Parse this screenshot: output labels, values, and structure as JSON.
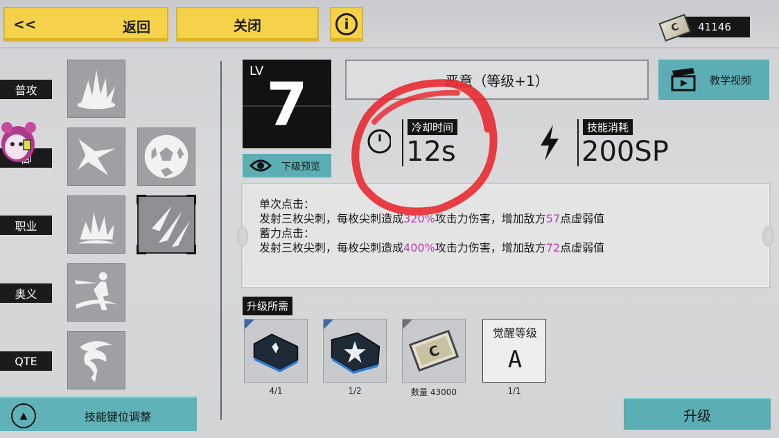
{
  "header": {
    "back_chevron": "<<",
    "back_label": "返回",
    "close_label": "关闭",
    "info_glyph": "i",
    "currency_value": "41146",
    "currency_icon": "ticket-icon"
  },
  "categories": [
    {
      "label": "普攻"
    },
    {
      "label": "御"
    },
    {
      "label": "职业"
    },
    {
      "label": "奥义"
    },
    {
      "label": "QTE"
    }
  ],
  "adjust_button": {
    "label": "技能键位调整",
    "icon": "rotate-icon"
  },
  "skill": {
    "lv_label": "LV",
    "level": "7",
    "preview_label": "下级预览",
    "name": "恶意（等级+1）",
    "tutorial_label": "教学视频",
    "cooldown_label": "冷却时间",
    "cooldown_value": "12s",
    "cost_label": "技能消耗",
    "cost_value": "200SP"
  },
  "description": {
    "line1": "单次点击：",
    "line2_a": "发射三枚尖刺，每枚尖刺造成",
    "line2_pct": "320%",
    "line2_b": "攻击力伤害，增加敌方",
    "line2_num": "57",
    "line2_c": "点虚弱值",
    "line3": "蓄力点击：",
    "line4_a": "发射三枚尖刺，每枚尖刺造成",
    "line4_pct": "400%",
    "line4_b": "攻击力伤害，增加敌方",
    "line4_num": "72",
    "line4_c": "点虚弱值"
  },
  "requirements": {
    "label": "升级所需",
    "items": [
      {
        "qty": "4/1"
      },
      {
        "qty": "1/2"
      },
      {
        "qty": "数量 43000"
      }
    ],
    "awaken_title": "觉醒等级",
    "awaken_grade": "A",
    "awaken_qty": "1/1"
  },
  "upgrade_label": "升级",
  "colors": {
    "accent_yellow": "#f6d24a",
    "accent_teal": "#5aaeb4",
    "highlight_purple": "#b640b0",
    "annotation_red": "#e8262c"
  }
}
